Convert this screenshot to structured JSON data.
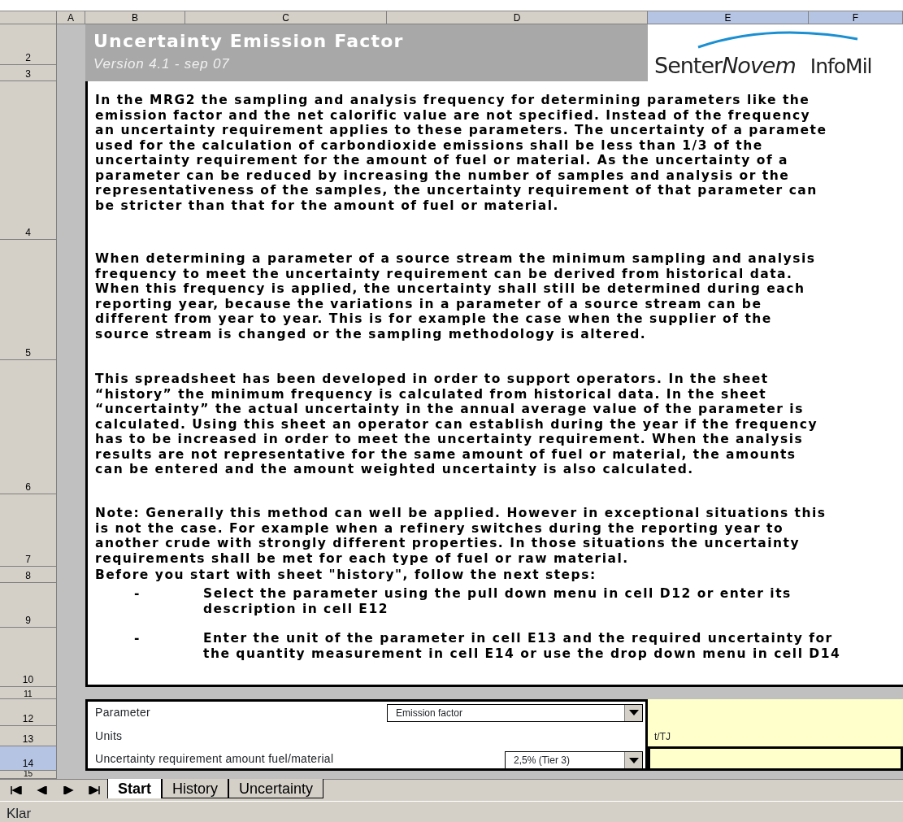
{
  "columns": [
    {
      "label": "A",
      "selected": false
    },
    {
      "label": "B",
      "selected": false
    },
    {
      "label": "C",
      "selected": false
    },
    {
      "label": "D",
      "selected": false
    },
    {
      "label": "E",
      "selected": true
    },
    {
      "label": "F",
      "selected": true
    }
  ],
  "rows": [
    {
      "label": "2",
      "selected": false
    },
    {
      "label": "3",
      "selected": false
    },
    {
      "label": "4",
      "selected": false
    },
    {
      "label": "5",
      "selected": false
    },
    {
      "label": "6",
      "selected": false
    },
    {
      "label": "7",
      "selected": false
    },
    {
      "label": "8",
      "selected": false
    },
    {
      "label": "9",
      "selected": false
    },
    {
      "label": "10",
      "selected": false
    },
    {
      "label": "11",
      "selected": false
    },
    {
      "label": "12",
      "selected": false
    },
    {
      "label": "13",
      "selected": false
    },
    {
      "label": "14",
      "selected": true
    },
    {
      "label": "15",
      "selected": false
    }
  ],
  "title": "Uncertainty Emission Factor",
  "version": "Version 4.1 - sep 07",
  "logo": {
    "name": "Senter",
    "name_italic": "Novem",
    "partner": "InfoMil"
  },
  "paragraphs": [
    "In the MRG2 the sampling and analysis frequency for determining parameters like the\nemission factor and the net calorific value are not specified. Instead of the frequency\nan uncertainty requirement applies to these parameters. The uncertainty of a paramete\nused for the calculation of carbondioxide emissions shall be less than 1/3 of the\nuncertainty requirement for the amount of fuel or material. As the uncertainty of a\nparameter can be reduced by increasing the number of samples and analysis or the\nrepresentativeness of the samples, the uncertainty requirement of that parameter can\nbe stricter than that for the amount of fuel or material.",
    "When determining a parameter of a source stream the minimum sampling and analysis\nfrequency to meet the uncertainty requirement can be derived from historical data.\nWhen this frequency is applied, the uncertainty shall still be determined during each\nreporting year, because the variations in a parameter of a source stream can be\ndifferent from year to year. This is for example the case when the supplier of the\nsource stream is changed or the sampling methodology is altered.",
    "This spreadsheet has been developed in order to support operators. In the sheet\n“history” the minimum frequency is calculated from historical data. In the sheet\n“uncertainty” the actual uncertainty in the annual average value of the parameter is\ncalculated. Using this sheet an operator can establish during the year if the frequency\nhas to be increased in order to meet the uncertainty requirement. When the analysis\nresults are not representative for the same amount of fuel or material, the amounts\ncan be entered and the amount weighted uncertainty is also calculated.",
    "Note: Generally this method can well be applied. However in exceptional situations this\nis not the case. For example when a refinery switches during the reporting year to\nanother crude with strongly different properties. In those situations the uncertainty\nrequirements shall be met for each type of fuel or raw material."
  ],
  "steps_intro": "Before you start with sheet \"history\", follow the next steps:",
  "steps": [
    {
      "bullet": "-",
      "text": "Select the parameter using the pull down menu in cell D12 or enter its\ndescription in cell E12"
    },
    {
      "bullet": "-",
      "text": "Enter the unit of the parameter in cell E13 and the required uncertainty for\nthe quantity measurement in cell E14 or use the drop down menu in cell D14"
    }
  ],
  "form": [
    {
      "label": "Parameter",
      "kind": "wide",
      "dropdown": "Emission factor",
      "selected": false
    },
    {
      "label": "Units",
      "value": "t/TJ",
      "selected": false
    },
    {
      "label": "Uncertainty requirement amount fuel/material",
      "kind": "narrow",
      "dropdown": "2,5% (Tier 3)",
      "selected": true
    }
  ],
  "sheet_tabs": [
    {
      "label": "Start",
      "selected": true
    },
    {
      "label": "History",
      "selected": false
    },
    {
      "label": "Uncertainty",
      "selected": false
    }
  ],
  "status_bar": "Klar"
}
